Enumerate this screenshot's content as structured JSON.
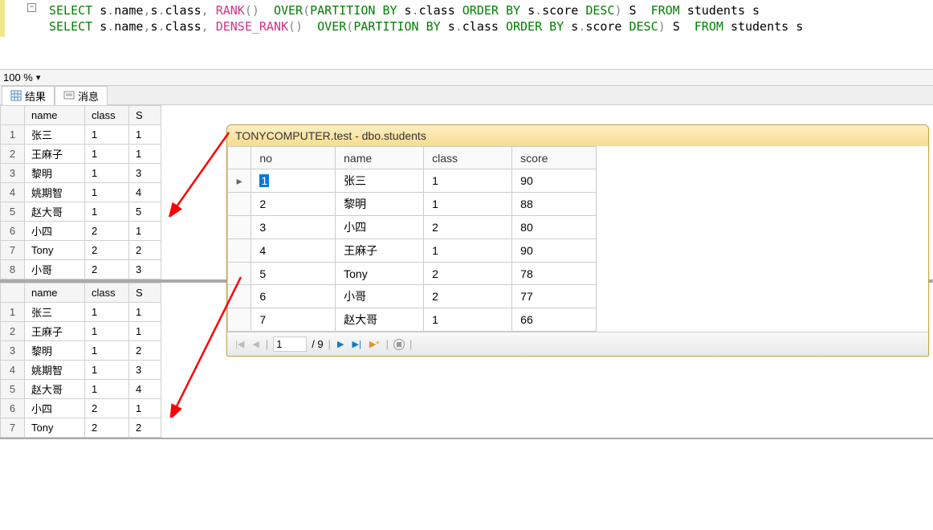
{
  "sql": {
    "line1": {
      "p1": "SELECT",
      "p2": " s",
      "p3": ".",
      "p4": "name",
      "p5": ",",
      "p6": "s",
      "p7": ".",
      "p8": "class",
      "p9": ",",
      "func": "RANK",
      "p10": "()",
      "p11": "OVER",
      "p12": "(",
      "p13": "PARTITION",
      "p14": "BY",
      "p15": "s",
      "p16": ".",
      "p17": "class",
      "p18": "ORDER",
      "p19": "BY",
      "p20": "s",
      "p21": ".",
      "p22": "score",
      "p23": "DESC",
      "p24": ")",
      "p25": "S",
      "p26": "FROM",
      "p27": "students",
      "p28": "s"
    },
    "line2": {
      "p1": "SELECT",
      "p2": " s",
      "p3": ".",
      "p4": "name",
      "p5": ",",
      "p6": "s",
      "p7": ".",
      "p8": "class",
      "p9": ",",
      "func": "DENSE_RANK",
      "p10": "()",
      "p11": "OVER",
      "p12": "(",
      "p13": "PARTITION",
      "p14": "BY",
      "p15": "s",
      "p16": ".",
      "p17": "class",
      "p18": "ORDER",
      "p19": "BY",
      "p20": "s",
      "p21": ".",
      "p22": "score",
      "p23": "DESC",
      "p24": ")",
      "p25": "S",
      "p26": "FROM",
      "p27": "students",
      "p28": "s"
    }
  },
  "zoom": "100 %",
  "tabs": {
    "results": "结果",
    "messages": "消息"
  },
  "grid": {
    "headers": {
      "name": "name",
      "class": "class",
      "s": "S"
    },
    "top": [
      {
        "row": "1",
        "name": "张三",
        "class": "1",
        "s": "1"
      },
      {
        "row": "2",
        "name": "王麻子",
        "class": "1",
        "s": "1"
      },
      {
        "row": "3",
        "name": "黎明",
        "class": "1",
        "s": "3"
      },
      {
        "row": "4",
        "name": "姚期智",
        "class": "1",
        "s": "4"
      },
      {
        "row": "5",
        "name": "赵大哥",
        "class": "1",
        "s": "5"
      },
      {
        "row": "6",
        "name": "小四",
        "class": "2",
        "s": "1"
      },
      {
        "row": "7",
        "name": "Tony",
        "class": "2",
        "s": "2"
      },
      {
        "row": "8",
        "name": "小哥",
        "class": "2",
        "s": "3"
      }
    ],
    "bottom": [
      {
        "row": "1",
        "name": "张三",
        "class": "1",
        "s": "1"
      },
      {
        "row": "2",
        "name": "王麻子",
        "class": "1",
        "s": "1"
      },
      {
        "row": "3",
        "name": "黎明",
        "class": "1",
        "s": "2"
      },
      {
        "row": "4",
        "name": "姚期智",
        "class": "1",
        "s": "3"
      },
      {
        "row": "5",
        "name": "赵大哥",
        "class": "1",
        "s": "4"
      },
      {
        "row": "6",
        "name": "小四",
        "class": "2",
        "s": "1"
      },
      {
        "row": "7",
        "name": "Tony",
        "class": "2",
        "s": "2"
      }
    ]
  },
  "dataWindow": {
    "title": "TONYCOMPUTER.test - dbo.students",
    "headers": {
      "no": "no",
      "name": "name",
      "class": "class",
      "score": "score"
    },
    "rows": [
      {
        "no": "1",
        "name": "张三",
        "class": "1",
        "score": "90"
      },
      {
        "no": "2",
        "name": "黎明",
        "class": "1",
        "score": "88"
      },
      {
        "no": "3",
        "name": "小四",
        "class": "2",
        "score": "80"
      },
      {
        "no": "4",
        "name": "王麻子",
        "class": "1",
        "score": "90"
      },
      {
        "no": "5",
        "name": "Tony",
        "class": "2",
        "score": "78"
      },
      {
        "no": "6",
        "name": "小哥",
        "class": "2",
        "score": "77"
      },
      {
        "no": "7",
        "name": "赵大哥",
        "class": "1",
        "score": "66"
      }
    ],
    "nav": {
      "current": "1",
      "total": "/ 9"
    }
  }
}
